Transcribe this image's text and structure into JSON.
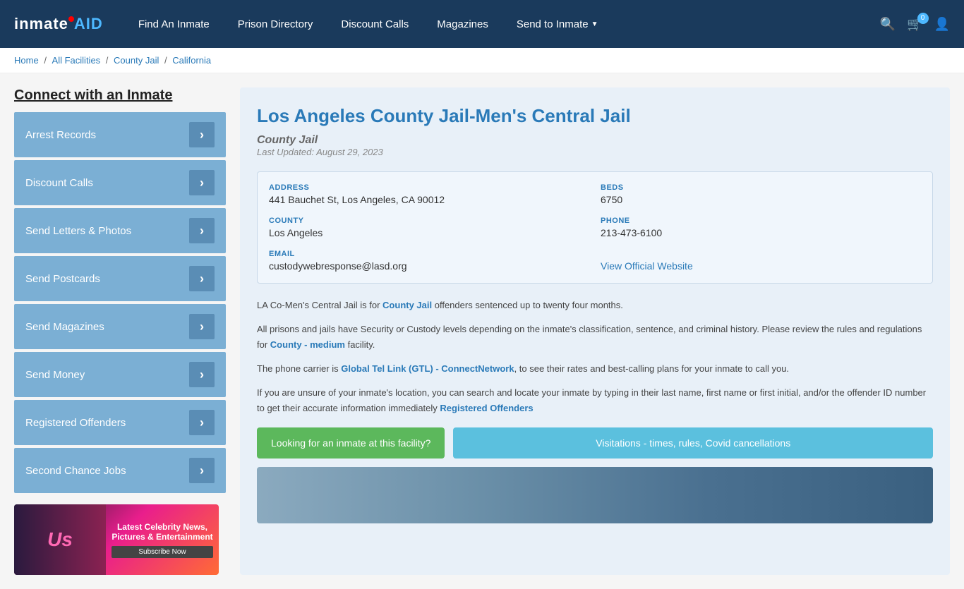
{
  "header": {
    "logo_text": "inmate",
    "logo_aid": "AID",
    "nav_items": [
      {
        "label": "Find An Inmate",
        "has_dropdown": false
      },
      {
        "label": "Prison Directory",
        "has_dropdown": false
      },
      {
        "label": "Discount Calls",
        "has_dropdown": false
      },
      {
        "label": "Magazines",
        "has_dropdown": false
      },
      {
        "label": "Send to Inmate",
        "has_dropdown": true
      }
    ],
    "cart_count": "0"
  },
  "breadcrumb": {
    "items": [
      "Home",
      "All Facilities",
      "County Jail",
      "California"
    ],
    "separators": [
      "/",
      "/",
      "/"
    ]
  },
  "sidebar": {
    "title": "Connect with an Inmate",
    "menu_items": [
      "Arrest Records",
      "Discount Calls",
      "Send Letters & Photos",
      "Send Postcards",
      "Send Magazines",
      "Send Money",
      "Registered Offenders",
      "Second Chance Jobs"
    ]
  },
  "ad": {
    "brand": "Us",
    "title": "Latest Celebrity News, Pictures & Entertainment",
    "btn_label": "Subscribe Now"
  },
  "facility": {
    "name": "Los Angeles County Jail-Men's Central Jail",
    "type": "County Jail",
    "last_updated": "Last Updated: August 29, 2023",
    "address_label": "ADDRESS",
    "address_value": "441 Bauchet St, Los Angeles, CA 90012",
    "county_label": "COUNTY",
    "county_value": "Los Angeles",
    "email_label": "EMAIL",
    "email_value": "custodywebresponse@lasd.org",
    "beds_label": "BEDS",
    "beds_value": "6750",
    "phone_label": "PHONE",
    "phone_value": "213-473-6100",
    "website_label": "View Official Website",
    "desc1": "LA Co-Men's Central Jail is for County Jail offenders sentenced up to twenty four months.",
    "desc2": "All prisons and jails have Security or Custody levels depending on the inmate's classification, sentence, and criminal history. Please review the rules and regulations for County - medium facility.",
    "desc3": "The phone carrier is Global Tel Link (GTL) - ConnectNetwork, to see their rates and best-calling plans for your inmate to call you.",
    "desc4": "If you are unsure of your inmate's location, you can search and locate your inmate by typing in their last name, first name or first initial, and/or the offender ID number to get their accurate information immediately Registered Offenders",
    "btn_inmate_label": "Looking for an inmate at this facility?",
    "btn_visitation_label": "Visitations - times, rules, Covid cancellations"
  }
}
